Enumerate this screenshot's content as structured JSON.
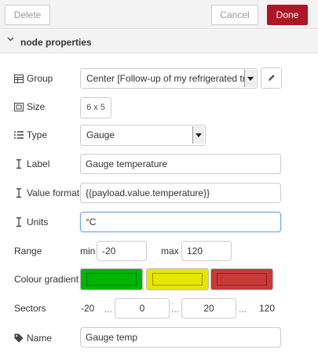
{
  "toolbar": {
    "delete_label": "Delete",
    "cancel_label": "Cancel",
    "done_label": "Done"
  },
  "section": {
    "title": "node properties"
  },
  "fields": {
    "group": {
      "label": "Group",
      "value": "Center [Follow-up of my refrigerated tr"
    },
    "size": {
      "label": "Size",
      "value": "6 x 5"
    },
    "type": {
      "label": "Type",
      "value": "Gauge"
    },
    "label": {
      "label": "Label",
      "value": "Gauge temperature"
    },
    "value_format": {
      "label": "Value format",
      "value": "{{payload.value.temperature}}"
    },
    "units": {
      "label": "Units",
      "value": "°C"
    },
    "range": {
      "label": "Range",
      "min_label": "min",
      "min_value": "-20",
      "max_label": "max",
      "max_value": "120"
    },
    "colour_gradient": {
      "label": "Colour gradient",
      "colors": [
        "#00b500",
        "#e6e600",
        "#ca3838"
      ]
    },
    "sectors": {
      "label": "Sectors",
      "start": "-20",
      "sep1": "...",
      "value1": "0",
      "sep2": "...",
      "value2": "20",
      "sep3": "...",
      "end": "120"
    },
    "name": {
      "label": "Name",
      "value": "Gauge temp"
    }
  },
  "icons": {
    "section_toggle": "chevron-down-icon",
    "group": "table-icon",
    "size": "resize-icon",
    "type": "list-icon",
    "label": "text-cursor-icon",
    "value_format": "text-cursor-icon",
    "units": "text-cursor-icon",
    "name": "tag-icon",
    "edit": "pencil-icon"
  },
  "colors": {
    "accent": "#ad1625",
    "focus": "#6aa6e6"
  }
}
